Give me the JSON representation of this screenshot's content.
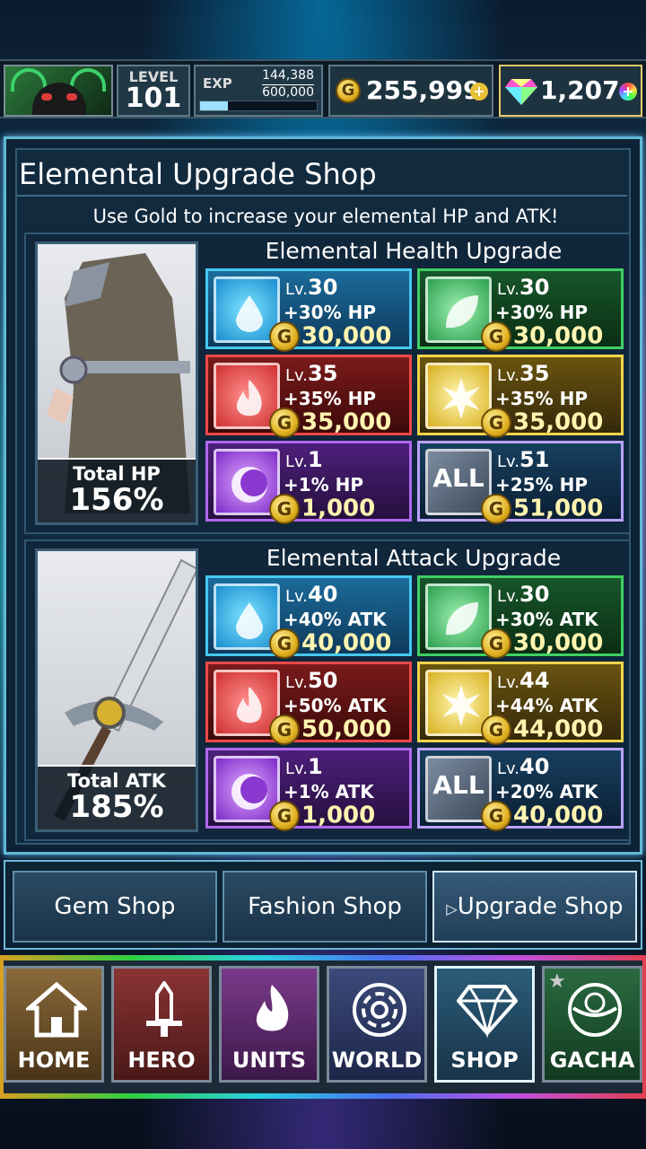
{
  "header": {
    "level_label": "LEVEL",
    "level": "101",
    "exp_label": "EXP",
    "exp_current": "144,388",
    "exp_max": "600,000",
    "exp_progress": 0.24,
    "gold": "255,999",
    "gems": "1,207",
    "coin_glyph": "G",
    "plus_glyph": "+"
  },
  "shop": {
    "title": "Elemental Upgrade Shop",
    "subtitle": "Use Gold to increase your elemental HP and ATK!"
  },
  "health": {
    "title": "Elemental Health Upgrade",
    "total_label": "Total HP",
    "total_value": "156%",
    "tiles": [
      {
        "element": "water",
        "icon": "water-drop-icon",
        "lv_prefix": "Lv.",
        "lv": "30",
        "pct": "+30% HP",
        "cost": "30,000"
      },
      {
        "element": "leaf",
        "icon": "leaf-icon",
        "lv_prefix": "Lv.",
        "lv": "30",
        "pct": "+30% HP",
        "cost": "30,000"
      },
      {
        "element": "fire",
        "icon": "fire-icon",
        "lv_prefix": "Lv.",
        "lv": "35",
        "pct": "+35% HP",
        "cost": "35,000"
      },
      {
        "element": "light",
        "icon": "sun-burst-icon",
        "lv_prefix": "Lv.",
        "lv": "35",
        "pct": "+35% HP",
        "cost": "35,000"
      },
      {
        "element": "dark",
        "icon": "crescent-icon",
        "lv_prefix": "Lv.",
        "lv": "1",
        "pct": "+1% HP",
        "cost": "1,000"
      },
      {
        "element": "all",
        "icon": "all-icon",
        "icon_text": "ALL",
        "lv_prefix": "Lv.",
        "lv": "51",
        "pct": "+25% HP",
        "cost": "51,000"
      }
    ]
  },
  "attack": {
    "title": "Elemental Attack Upgrade",
    "total_label": "Total ATK",
    "total_value": "185%",
    "tiles": [
      {
        "element": "water",
        "icon": "water-drop-icon",
        "lv_prefix": "Lv.",
        "lv": "40",
        "pct": "+40% ATK",
        "cost": "40,000"
      },
      {
        "element": "leaf",
        "icon": "leaf-icon",
        "lv_prefix": "Lv.",
        "lv": "30",
        "pct": "+30% ATK",
        "cost": "30,000"
      },
      {
        "element": "fire",
        "icon": "fire-icon",
        "lv_prefix": "Lv.",
        "lv": "50",
        "pct": "+50% ATK",
        "cost": "50,000"
      },
      {
        "element": "light",
        "icon": "sun-burst-icon",
        "lv_prefix": "Lv.",
        "lv": "44",
        "pct": "+44% ATK",
        "cost": "44,000"
      },
      {
        "element": "dark",
        "icon": "crescent-icon",
        "lv_prefix": "Lv.",
        "lv": "1",
        "pct": "+1% ATK",
        "cost": "1,000"
      },
      {
        "element": "all",
        "icon": "all-icon",
        "icon_text": "ALL",
        "lv_prefix": "Lv.",
        "lv": "40",
        "pct": "+20% ATK",
        "cost": "40,000"
      }
    ]
  },
  "tabs": [
    {
      "label": "Gem Shop"
    },
    {
      "label": "Fashion Shop"
    },
    {
      "label": "Upgrade Shop",
      "active": true
    }
  ],
  "nav": [
    {
      "label": "HOME",
      "icon": "home-icon"
    },
    {
      "label": "HERO",
      "icon": "sword-icon"
    },
    {
      "label": "UNITS",
      "icon": "flame-icon"
    },
    {
      "label": "WORLD",
      "icon": "world-icon"
    },
    {
      "label": "SHOP",
      "icon": "diamond-icon",
      "active": true
    },
    {
      "label": "GACHA",
      "icon": "gacha-ball-icon"
    }
  ]
}
